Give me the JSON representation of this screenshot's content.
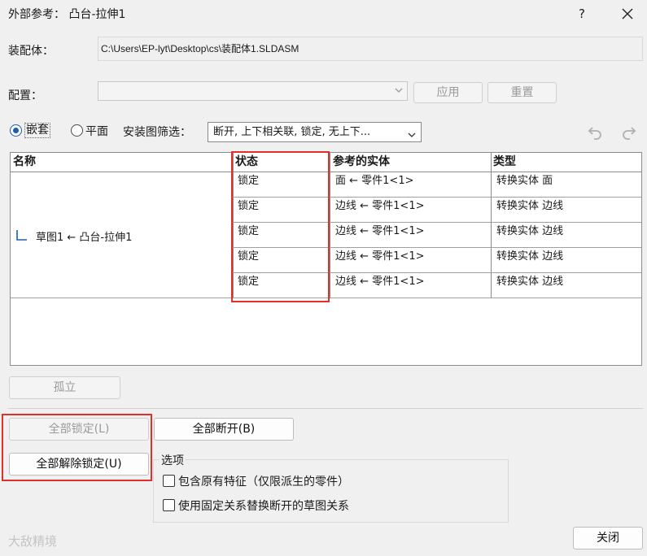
{
  "window": {
    "title": "外部参考：  凸台-拉伸1",
    "help_label": "?"
  },
  "assembly": {
    "label": "装配体：",
    "path": "C:\\Users\\EP-lyt\\Desktop\\cs\\装配体1.SLDASM"
  },
  "config": {
    "label": "配置：",
    "value": "",
    "apply_label": "应用",
    "reset_label": "重置"
  },
  "view_mode": {
    "nested_label": "嵌套",
    "flat_label": "平面",
    "selected": "nested"
  },
  "filter": {
    "label": "安装图筛选：",
    "value": "断开, 上下相关联, 锁定, 无上下..."
  },
  "table": {
    "headers": [
      "名称",
      "状态",
      "参考的实体",
      "类型"
    ],
    "name_cell": "草图1 ← 凸台-拉伸1",
    "rows": [
      {
        "status": "锁定",
        "entity": "面 ← 零件1<1>",
        "type": "转换实体 面"
      },
      {
        "status": "锁定",
        "entity": "边线 ← 零件1<1>",
        "type": "转换实体 边线"
      },
      {
        "status": "锁定",
        "entity": "边线 ← 零件1<1>",
        "type": "转换实体 边线"
      },
      {
        "status": "锁定",
        "entity": "边线 ← 零件1<1>",
        "type": "转换实体 边线"
      },
      {
        "status": "锁定",
        "entity": "边线 ← 零件1<1>",
        "type": "转换实体 边线"
      }
    ]
  },
  "buttons": {
    "isolate": "孤立",
    "lock_all": "全部锁定(L)",
    "break_all": "全部断开(B)",
    "unlock_all": "全部解除锁定(U)",
    "close": "关闭"
  },
  "options": {
    "title": "选项",
    "items": [
      {
        "label": "包含原有特征（仅限派生的零件）",
        "checked": false
      },
      {
        "label": "使用固定关系替换断开的草图关系",
        "checked": false
      }
    ]
  },
  "watermark": "大敌精境",
  "colors": {
    "accent": "#1e5bb5",
    "highlight_box": "#e0302a"
  }
}
